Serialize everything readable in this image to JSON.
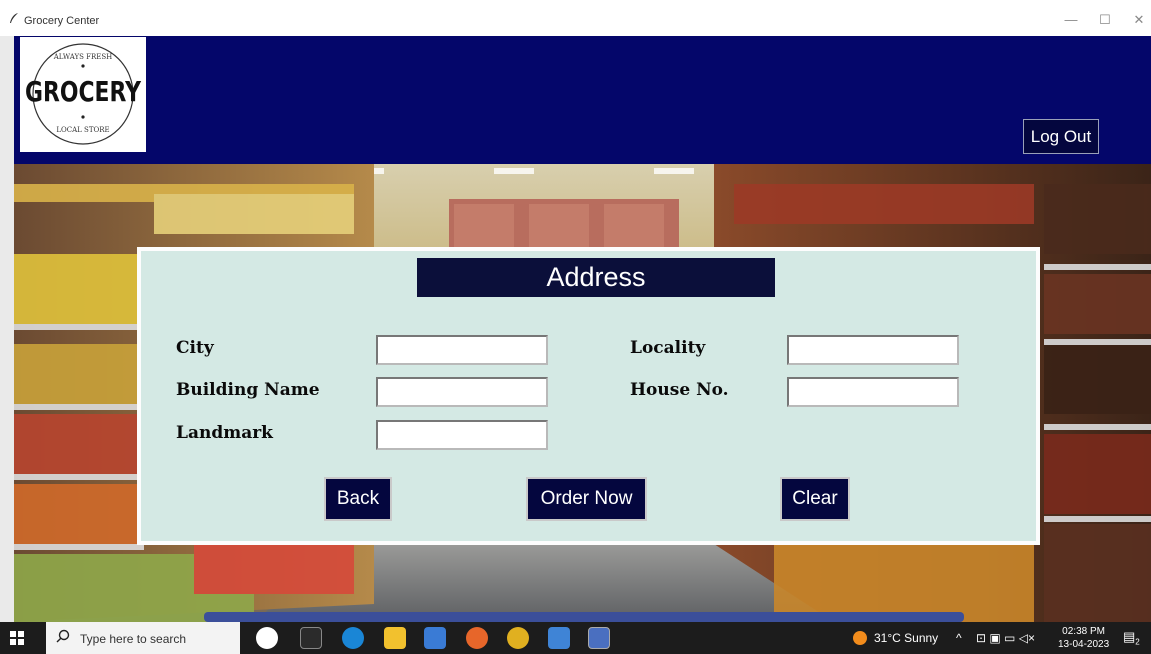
{
  "window": {
    "title": "Grocery Center",
    "minimize_glyph": "—",
    "maximize_glyph": "☐",
    "close_glyph": "✕"
  },
  "header": {
    "logo": {
      "top_text": "ALWAYS FRESH",
      "main_text": "GROCERY",
      "bottom_text": "LOCAL STORE"
    },
    "logout_label": "Log Out"
  },
  "form": {
    "title": "Address",
    "fields": {
      "city": {
        "label": "City",
        "value": ""
      },
      "locality": {
        "label": "Locality",
        "value": ""
      },
      "building": {
        "label": "Building Name",
        "value": ""
      },
      "house_no": {
        "label": "House No.",
        "value": ""
      },
      "landmark": {
        "label": "Landmark",
        "value": ""
      }
    },
    "buttons": {
      "back": "Back",
      "order_now": "Order Now",
      "clear": "Clear"
    }
  },
  "taskbar": {
    "search_placeholder": "Type here to search",
    "weather": "31°C  Sunny",
    "time": "02:38 PM",
    "date": "13-04-2023",
    "notification_count": "2"
  },
  "colors": {
    "header_bg": "#04066a",
    "button_bg": "#04063e",
    "panel_bg": "#d4e9e4",
    "title_bg": "#0b0f3a"
  }
}
